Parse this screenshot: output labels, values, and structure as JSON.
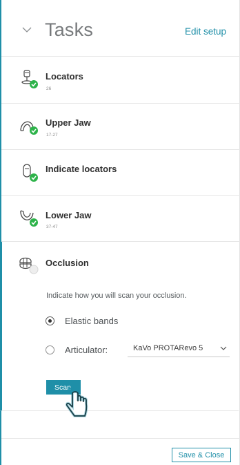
{
  "header": {
    "title": "Tasks",
    "edit_setup": "Edit setup"
  },
  "tasks": [
    {
      "name": "Locators",
      "sub": "26",
      "icon": "locator-icon",
      "status": "complete"
    },
    {
      "name": "Upper Jaw",
      "sub": "17-27",
      "icon": "upper-jaw-icon",
      "status": "complete"
    },
    {
      "name": "Indicate locators",
      "sub": "",
      "icon": "indicate-locator-icon",
      "status": "complete"
    },
    {
      "name": "Lower Jaw",
      "sub": "37-47",
      "icon": "lower-jaw-icon",
      "status": "complete"
    },
    {
      "name": "Occlusion",
      "sub": "",
      "icon": "occlusion-icon",
      "status": "pending"
    }
  ],
  "occlusion": {
    "instruction": "Indicate how you will scan your occlusion.",
    "options": [
      {
        "label": "Elastic bands",
        "checked": true
      },
      {
        "label": "Articulator:",
        "checked": false
      }
    ],
    "articulator_select": "KaVo PROTARevo 5",
    "scan_button": "Scan"
  },
  "footer": {
    "save_close": "Save & Close"
  },
  "colors": {
    "accent": "#1f8fa8",
    "check_green": "#2db34a"
  }
}
